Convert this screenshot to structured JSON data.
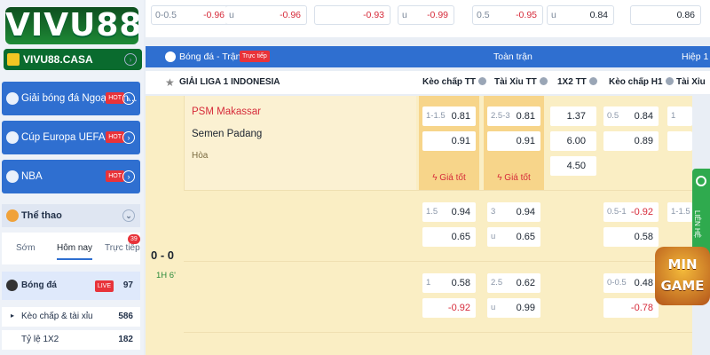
{
  "brand": {
    "logo": "VIVU88",
    "domain": "VIVU88.CASA"
  },
  "sidebar": {
    "leagues": [
      {
        "label": "Giải bóng đá Ngoại hạn...",
        "hot": "HOT"
      },
      {
        "label": "Cúp Europa UEFA",
        "hot": "HOT"
      },
      {
        "label": "NBA",
        "hot": "HOT"
      }
    ],
    "sport_header": "Thể thao",
    "tabs": [
      {
        "label": "Sớm"
      },
      {
        "label": "Hôm nay"
      },
      {
        "label": "Trực tiếp",
        "badge": "39"
      }
    ],
    "items": [
      {
        "label": "Bóng đá",
        "badge": "LIVE",
        "count": "97"
      },
      {
        "label": "Kèo chấp & tài xỉu",
        "count": "586"
      },
      {
        "label": "Tỷ lệ 1X2",
        "count": "182"
      }
    ]
  },
  "topbar": {
    "cells": [
      {
        "handicap": "0-0.5",
        "value": "-0.96"
      },
      {
        "handicap": "u",
        "value": "-0.96"
      },
      {
        "handicap": "",
        "value": "-0.93"
      },
      {
        "handicap": "u",
        "value": "-0.99"
      },
      {
        "handicap": "0.5",
        "value": "-0.95"
      },
      {
        "handicap": "u",
        "value": "0.84"
      },
      {
        "handicap": "",
        "value": "0.86"
      }
    ]
  },
  "market_header": {
    "title": "Bóng đá - Trận đấu",
    "live": "Trực tiếp",
    "full": "Toàn trận",
    "half": "Hiệp 1"
  },
  "league_row": {
    "name": "GIẢI LIGA 1 INDONESIA",
    "cols": [
      "Kèo chấp TT",
      "Tài Xỉu TT",
      "1X2 TT",
      "Kèo chấp H1",
      "Tài Xỉu"
    ]
  },
  "match": {
    "home": "PSM Makassar",
    "away": "Semen Padang",
    "draw": "Hòa",
    "score": "0 - 0",
    "time": "1H 6'",
    "good_odds": "Giá tốt",
    "rows": [
      {
        "hc": "1-1.5",
        "hc_home": "0.81",
        "hc_away": "0.91",
        "ou": "2.5-3",
        "ou_over": "0.81",
        "ou_under": "0.91",
        "x1": "1.37",
        "x2": "6.00",
        "xx": "4.50",
        "h1hc": "0.5",
        "h1_home": "0.84",
        "h1_away": "0.89",
        "h1ou": "1"
      },
      {
        "hc": "1.5",
        "hc_home": "0.94",
        "hc_away": "0.65",
        "ou": "3",
        "ou_over": "0.94",
        "ou_under": "0.65",
        "h1hc": "0.5-1",
        "h1_home": "-0.92",
        "h1_away": "0.58",
        "h1ou": "1-1.5"
      },
      {
        "hc": "1",
        "hc_home": "0.58",
        "hc_away": "-0.92",
        "ou": "2.5",
        "ou_over": "0.62",
        "ou_under": "0.99",
        "h1hc": "0-0.5",
        "h1_home": "0.48",
        "h1_away": "-0.78"
      }
    ]
  },
  "side_tab": {
    "label": "LIÊN HỆ"
  },
  "promo": {
    "line1": "MIN",
    "line2": "GAME"
  }
}
